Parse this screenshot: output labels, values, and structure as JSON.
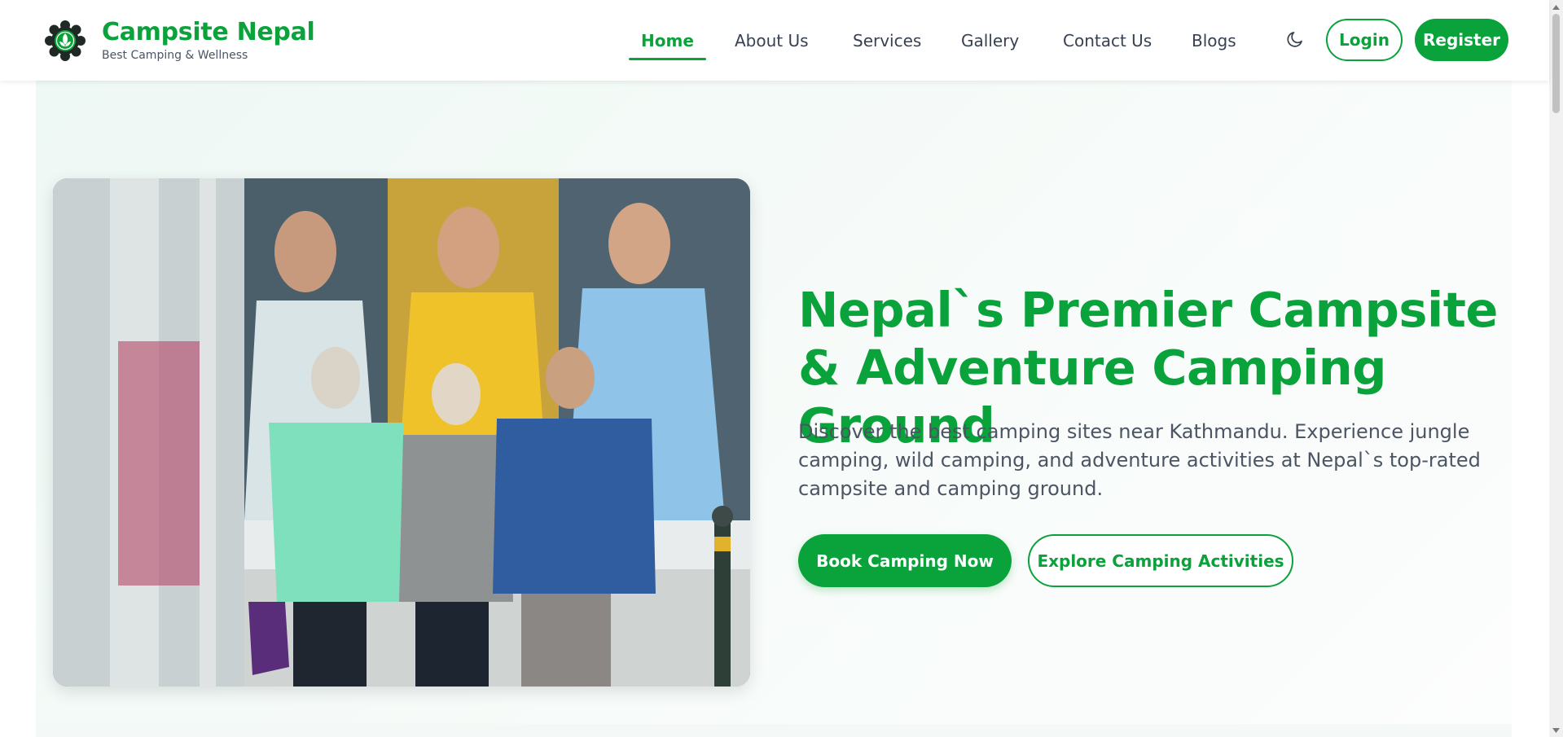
{
  "colors": {
    "brand_green": "#0aa23b",
    "text_gray": "#4b5563",
    "hero_bg": "#eef8f4"
  },
  "brand": {
    "title": "Campsite Nepal",
    "tagline": "Best Camping & Wellness",
    "logo_icon": "lotus-logo-icon"
  },
  "nav": {
    "items": [
      {
        "label": "Home",
        "active": true
      },
      {
        "label": "About Us",
        "active": false
      },
      {
        "label": "Services",
        "active": false
      },
      {
        "label": "Gallery",
        "active": false
      },
      {
        "label": "Contact Us",
        "active": false
      },
      {
        "label": "Blogs",
        "active": false
      }
    ],
    "theme_toggle_icon": "moon-icon",
    "login_label": "Login",
    "register_label": "Register"
  },
  "hero": {
    "title": "Nepal`s Premier Campsite & Adventure Camping Ground",
    "description": "Discover the best camping sites near Kathmandu. Experience jungle camping, wild camping, and adventure activities at Nepal`s top-rated campsite and camping ground.",
    "primary_button": "Book Camping Now",
    "secondary_button": "Explore Camping Activities",
    "image_subject": "three elderly people walking arm in arm past football posters"
  }
}
